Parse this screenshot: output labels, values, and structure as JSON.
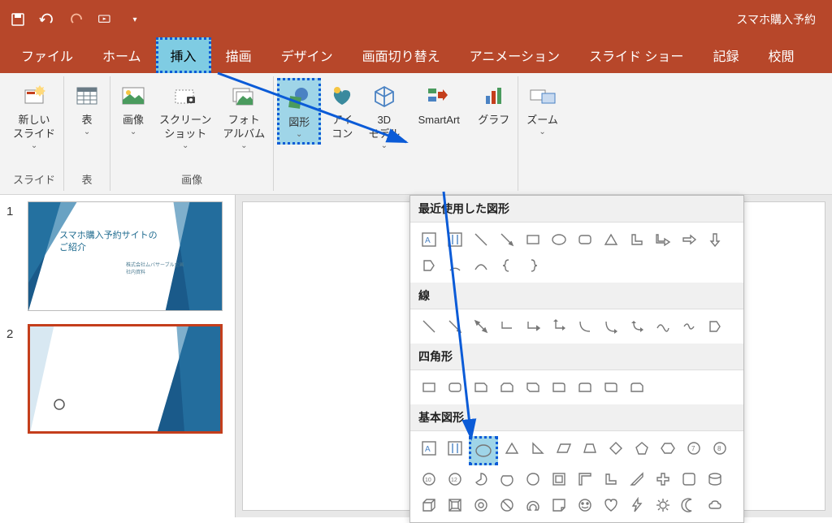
{
  "titlebar": {
    "title": "スマホ購入予約"
  },
  "tabs": {
    "file": "ファイル",
    "home": "ホーム",
    "insert": "挿入",
    "draw": "描画",
    "design": "デザイン",
    "transitions": "画面切り替え",
    "animations": "アニメーション",
    "slideshow": "スライド ショー",
    "record": "記録",
    "review": "校閲"
  },
  "ribbon": {
    "groups": {
      "slides": {
        "label": "スライド",
        "new_slide": "新しい\nスライド"
      },
      "tables": {
        "label": "表",
        "table": "表"
      },
      "images": {
        "label": "画像",
        "image": "画像",
        "screenshot": "スクリーン\nショット",
        "photo_album": "フォト\nアルバム"
      },
      "illustrations": {
        "shapes": "図形",
        "icons": "アイ\nコン",
        "models3d": "3D\nモデル",
        "smartart": "SmartArt",
        "chart": "グラフ"
      },
      "zoom_group": {
        "zoom": "ズーム"
      }
    }
  },
  "shapes_popup": {
    "recent": "最近使用した図形",
    "lines": "線",
    "rectangles": "四角形",
    "basic": "基本図形"
  },
  "thumbnails": {
    "slide1": {
      "num": "1",
      "title": "スマホ購入予約サイトの\nご紹介",
      "sub": "株式会社ムバサーブル企画\n社内資料"
    },
    "slide2": {
      "num": "2"
    }
  }
}
